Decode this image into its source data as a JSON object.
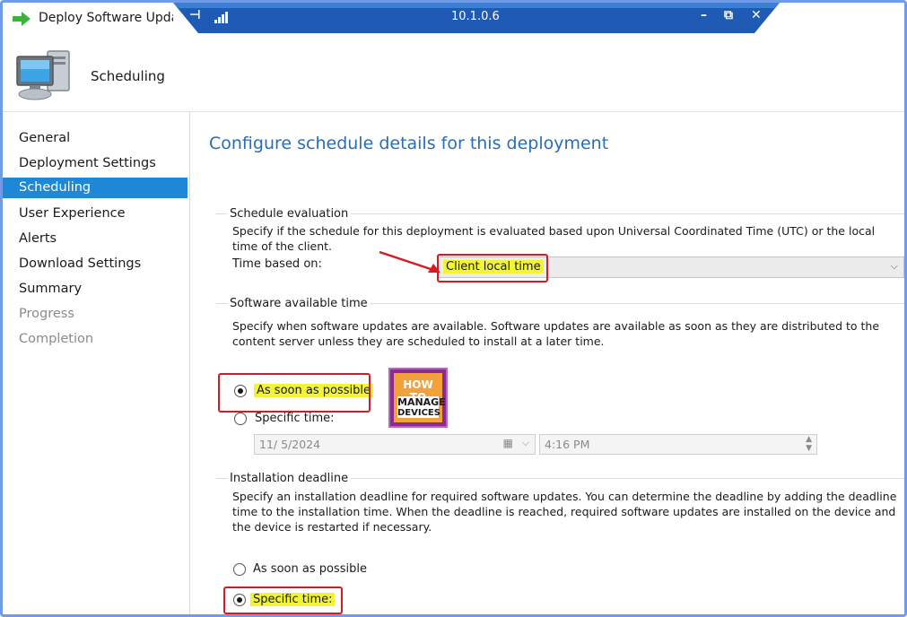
{
  "window": {
    "title": "Deploy Software Updates",
    "remote_host": "10.1.0.6"
  },
  "header": {
    "title": "Scheduling"
  },
  "sidebar": {
    "items": [
      {
        "label": "General"
      },
      {
        "label": "Deployment Settings"
      },
      {
        "label": "Scheduling"
      },
      {
        "label": "User Experience"
      },
      {
        "label": "Alerts"
      },
      {
        "label": "Download Settings"
      },
      {
        "label": "Summary"
      },
      {
        "label": "Progress"
      },
      {
        "label": "Completion"
      }
    ],
    "active_index": 2
  },
  "main": {
    "title": "Configure schedule details for this deployment",
    "schedule_evaluation": {
      "label": "Schedule evaluation",
      "description": "Specify if the schedule for this deployment is evaluated based upon Universal Coordinated Time (UTC) or the local time of the client.",
      "time_based_on_label": "Time based on:",
      "time_based_on_value": "Client local time"
    },
    "software_available_time": {
      "label": "Software available time",
      "description": "Specify when software updates are available. Software updates are available as soon as they are distributed to the content server unless they are scheduled to install at a later time.",
      "option_asap": "As soon as possible",
      "option_specific": "Specific time:",
      "selected": "asap",
      "date_value": "11/  5/2024",
      "time_value": "4:16 PM"
    },
    "installation_deadline": {
      "label": "Installation deadline",
      "description": "Specify an installation deadline for required software updates. You can determine the deadline by adding the deadline time to the installation time. When the deadline is reached, required software updates are installed on the device and the device is restarted if necessary.",
      "option_asap": "As soon as possible",
      "option_specific": "Specific time:",
      "selected": "specific"
    }
  },
  "watermark": {
    "line1": "HOW TO",
    "line2": "MANAGE",
    "line3": "DEVICES"
  },
  "colors": {
    "accent": "#1e87d6",
    "title_blue": "#2a6cb8",
    "highlight_yellow": "#f4f437",
    "callout_red": "#d71920",
    "frame_blue": "#6f9be8"
  }
}
